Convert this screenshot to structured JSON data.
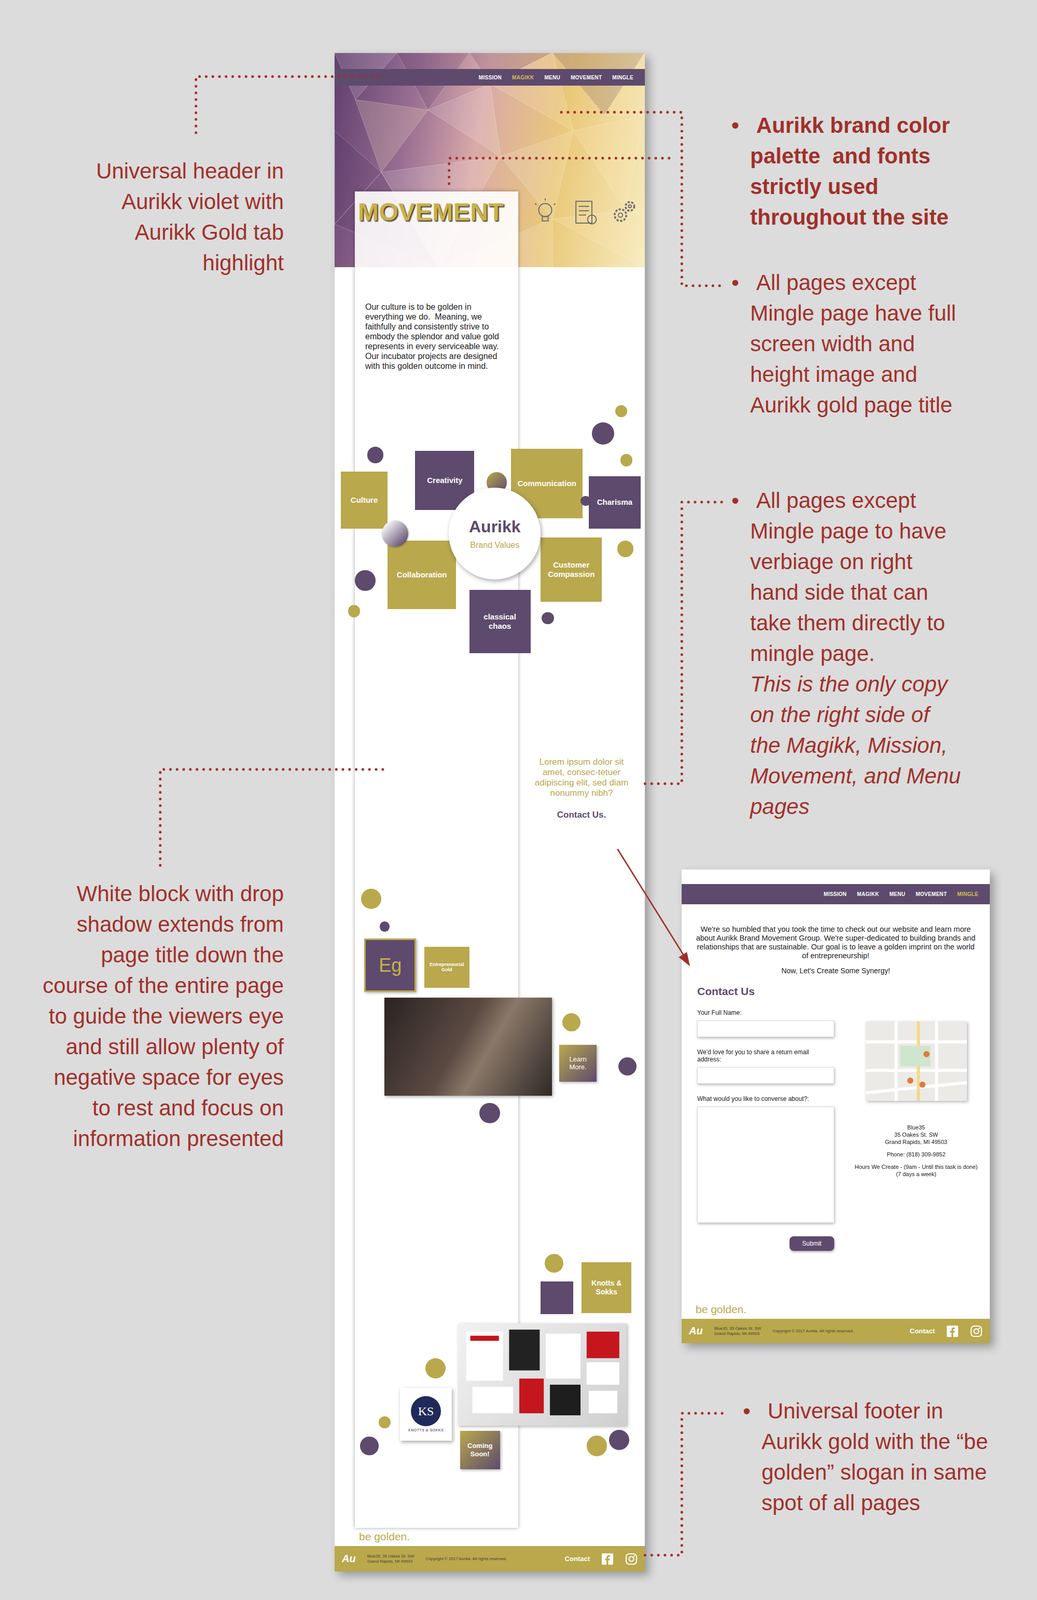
{
  "notes_left": [
    {
      "text": "Universal header in Aurikk violet with Aurikk Gold tab highlight"
    },
    {
      "text": "White block with drop shadow extends from page title down the course of the entire page to guide the viewers eye and still allow plenty of negative space for eyes to rest and focus on information presented"
    }
  ],
  "notes_right": [
    {
      "bullet": "•",
      "kind": "heading",
      "text": "Aurikk brand color palette  and fonts strictly used throughout the site"
    },
    {
      "bullet": "•",
      "kind": "note",
      "text": "All pages except Mingle page have full screen width and height image and Aurikk gold page title"
    },
    {
      "bullet": "•",
      "kind": "note",
      "text": "All pages except Mingle page to have verbiage on right hand side that can take them directly to mingle page.",
      "aside": "This is the only copy on the right side of the Magikk, Mission, Movement, and Menu pages"
    },
    {
      "bullet": "•",
      "kind": "note",
      "text": "Universal footer in Aurikk gold with the “be golden” slogan in same spot of all pages"
    }
  ],
  "site": {
    "nav": [
      {
        "label": "MISSION",
        "selected": false
      },
      {
        "label": "MAGIKK",
        "selected": true
      },
      {
        "label": "MENU",
        "selected": false
      },
      {
        "label": "MOVEMENT",
        "selected": false
      },
      {
        "label": "MINGLE",
        "selected": false
      }
    ],
    "title": "MOVEMENT",
    "intro": "Our culture is to be golden in everything we do.  Meaning, we faithfully and consistently strive to embody the splendor and value gold represents in every serviceable way.  Our incubator projects are designed with this golden outcome in mind.",
    "brand": {
      "logo": "Aurikk",
      "caption": "Brand Values",
      "values": [
        {
          "label": "Culture",
          "color": "#b9a84c"
        },
        {
          "label": "Creativity",
          "color": "#5d4a6d"
        },
        {
          "label": "Communication",
          "color": "#b9a84c"
        },
        {
          "label": "Charisma",
          "color": "#5d4a6d"
        },
        {
          "label": "Collaboration",
          "color": "#b9a84c"
        },
        {
          "label": "Customer Compassion",
          "color": "#b9a84c"
        },
        {
          "label": "classical chaos",
          "color": "#5d4a6d"
        }
      ]
    },
    "cta": {
      "text": "Lorem ipsum dolor sit amet, consec-tetuer adipiscing elit, sed diam nonummy nibh?",
      "link": "Contact Us."
    },
    "eg": {
      "logo": "Eg",
      "label": "Entrepreneurial Gold",
      "button": "Learn More."
    },
    "ks": {
      "label": "Knotts & Sokks",
      "logo": "KS",
      "logo_name": "KNOTTS & SOKKS",
      "button": "Coming Soon!"
    },
    "slogan": "be golden.",
    "footer": {
      "logo": "Au",
      "address": [
        "Blue35, 35 Oakes St. SW",
        "Grand Rapids, MI 49503"
      ],
      "copyright": "Copyright © 2017 Aurikk. All rights reserved.",
      "contact": "Contact"
    }
  },
  "mingle": {
    "nav": [
      {
        "label": "MISSION",
        "selected": false
      },
      {
        "label": "MAGIKK",
        "selected": false
      },
      {
        "label": "MENU",
        "selected": false
      },
      {
        "label": "MOVEMENT",
        "selected": false
      },
      {
        "label": "MINGLE",
        "selected": true
      }
    ],
    "intro": "We're so humbled that you took the time to check out our website and learn more about Aurikk Brand Movement Group. We're super-dedicated to building brands and relationships that are sustainable. Our goal is to leave a golden imprint on the world of entrepreneurship!",
    "tagline": "Now, Let's Create Some Synergy!",
    "form": {
      "title": "Contact Us",
      "fields": [
        {
          "label": "Your Full Name:",
          "kind": "input"
        },
        {
          "label": "We'd love for you to share a return email address:",
          "kind": "input"
        },
        {
          "label": "What would you like to converse about?:",
          "kind": "textarea"
        }
      ],
      "submit": "Submit"
    },
    "address": [
      "Blue35",
      "35 Oakes St. SW",
      "Grand Rapids, MI 49503"
    ],
    "phone": "Phone: (818) 309-9852",
    "hours": [
      "Hours We Create - (9am - Until this task is done)",
      "(7 days a week)"
    ],
    "slogan": "be golden.",
    "footer": {
      "logo": "Au",
      "address": [
        "Blue35, 35 Oakes St. SW",
        "Grand Rapids, MI 49503"
      ],
      "copyright": "Copyright © 2017 Aurikk. All rights reserved.",
      "contact": "Contact"
    }
  }
}
